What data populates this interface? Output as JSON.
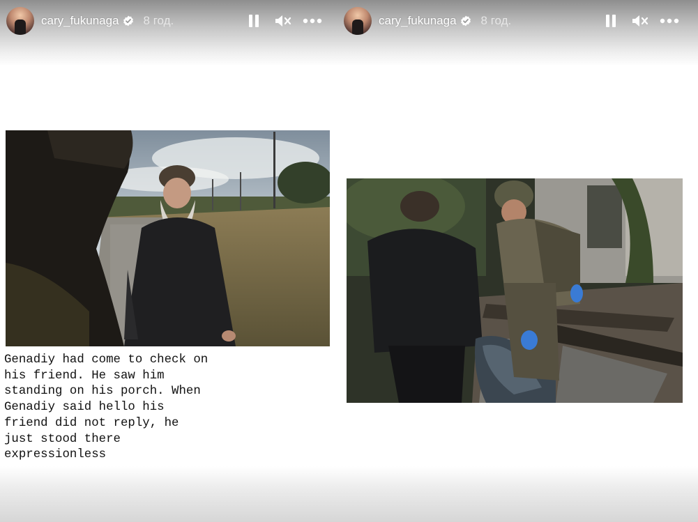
{
  "stories": [
    {
      "username": "cary_fukunaga",
      "time": "8 год.",
      "caption": "Genadiy had come to check on\nhis friend. He saw him\nstanding on his porch. When\nGenadiy said hello his\nfriend did not reply, he\njust stood there\nexpressionless"
    },
    {
      "username": "cary_fukunaga",
      "time": "8 год."
    }
  ],
  "icons": {
    "pause": "pause-icon",
    "mute": "mute-icon",
    "more": "more-icon",
    "verified": "verified-badge-icon"
  },
  "colors": {
    "header_text": "#ffffff",
    "time_text": "#e6e6e6",
    "caption_text": "#111111"
  }
}
